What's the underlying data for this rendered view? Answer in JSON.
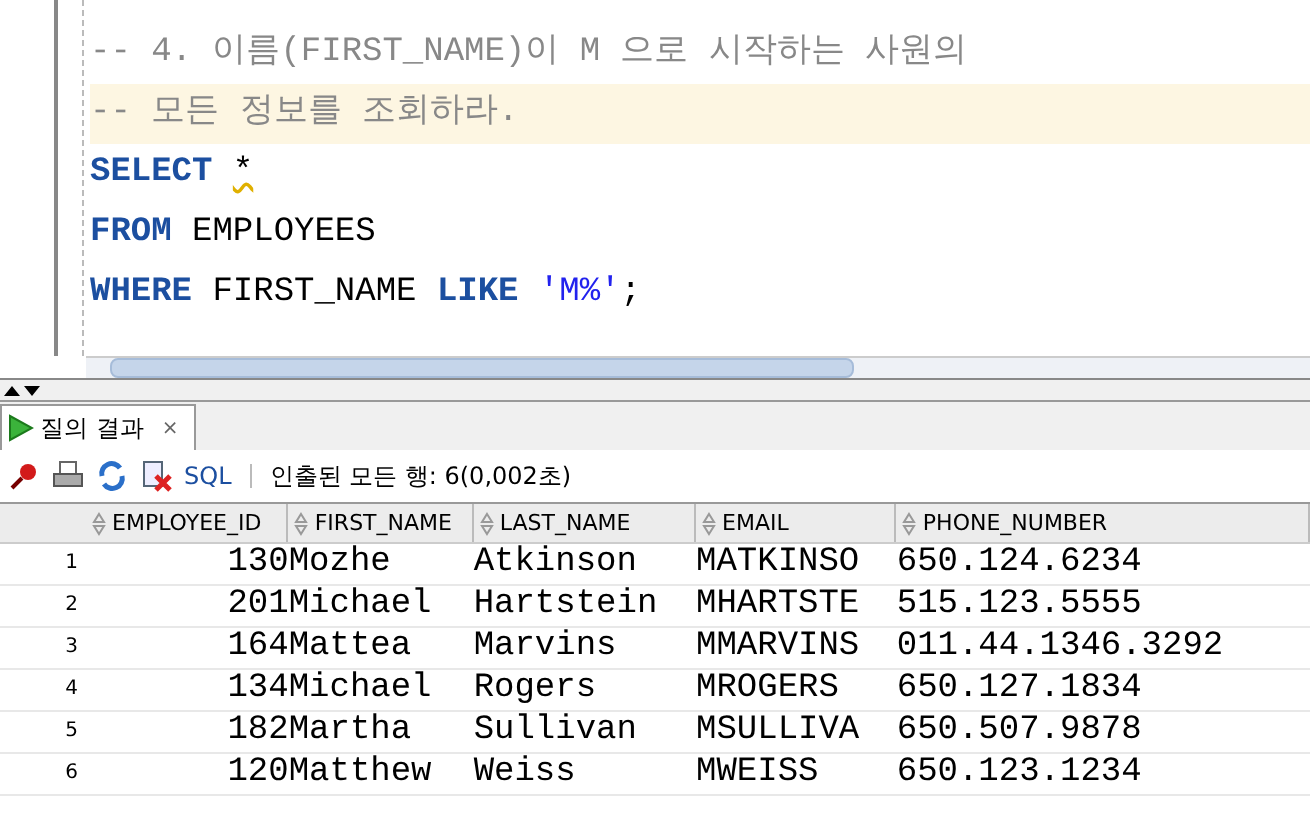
{
  "editor": {
    "lines": [
      {
        "current": false,
        "tokens": [
          {
            "kind": "comment",
            "text": "-- 4. 이름(FIRST_NAME)이 M 으로 시작하는 사원의"
          }
        ]
      },
      {
        "current": true,
        "tokens": [
          {
            "kind": "comment",
            "text": "-- 모든 정보를 조회하라."
          }
        ]
      },
      {
        "current": false,
        "tokens": [
          {
            "kind": "keyword",
            "text": "SELECT "
          },
          {
            "kind": "warning",
            "text": "*"
          }
        ]
      },
      {
        "current": false,
        "tokens": [
          {
            "kind": "keyword",
            "text": "FROM"
          },
          {
            "kind": "plain",
            "text": " EMPLOYEES"
          }
        ]
      },
      {
        "current": false,
        "tokens": [
          {
            "kind": "keyword",
            "text": "WHERE"
          },
          {
            "kind": "plain",
            "text": " FIRST_NAME "
          },
          {
            "kind": "keyword",
            "text": "LIKE"
          },
          {
            "kind": "string",
            "text": " 'M%'"
          },
          {
            "kind": "plain",
            "text": ";"
          }
        ]
      }
    ]
  },
  "results": {
    "tab": {
      "label": "질의 결과",
      "close": "×",
      "selected": true
    },
    "toolbar": {
      "sql": "SQL",
      "status": "인출된 모든 행: 6(0,002초)"
    },
    "table": {
      "columns": [
        "EMPLOYEE_ID",
        "FIRST_NAME",
        "LAST_NAME",
        "EMAIL",
        "PHONE_NUMBER"
      ],
      "rows": [
        {
          "num": "1",
          "cells": [
            "130",
            "Mozhe",
            "Atkinson",
            "MATKINSO",
            "650.124.6234"
          ]
        },
        {
          "num": "2",
          "cells": [
            "201",
            "Michael",
            "Hartstein",
            "MHARTSTE",
            "515.123.5555"
          ]
        },
        {
          "num": "3",
          "cells": [
            "164",
            "Mattea",
            "Marvins",
            "MMARVINS",
            "011.44.1346.3292"
          ]
        },
        {
          "num": "4",
          "cells": [
            "134",
            "Michael",
            "Rogers",
            "MROGERS",
            "650.127.1834"
          ]
        },
        {
          "num": "5",
          "cells": [
            "182",
            "Martha",
            "Sullivan",
            "MSULLIVA",
            "650.507.9878"
          ]
        },
        {
          "num": "6",
          "cells": [
            "120",
            "Matthew",
            "Weiss",
            "MWEISS",
            "650.123.1234"
          ]
        }
      ]
    }
  }
}
